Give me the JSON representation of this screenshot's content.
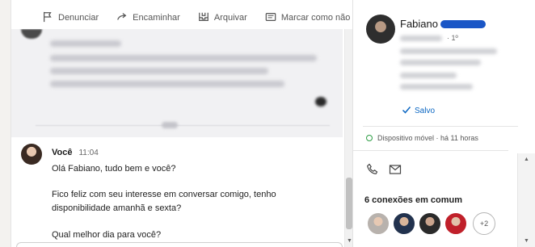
{
  "toolbar": {
    "report_label": "Denunciar",
    "forward_label": "Encaminhar",
    "archive_label": "Arquivar",
    "mark_unread_label": "Marcar como não lida"
  },
  "message": {
    "sender": "Você",
    "time": "11:04",
    "lines": [
      "Olá Fabiano, tudo bem e você?",
      "Fico feliz com seu interesse em conversar comigo, tenho",
      "disponibilidade amanhã e sexta?",
      "Qual melhor dia para você?"
    ]
  },
  "profile": {
    "name": "Fabiano",
    "degree": "· 1º",
    "saved_label": "Salvo",
    "status": "Dispositivo móvel · há 11 horas",
    "mutual_title": "6 conexões em comum",
    "mutual_more": "+2"
  },
  "icons": {
    "report": "flag-icon",
    "forward": "forward-arrow-icon",
    "archive": "archive-icon",
    "mark_unread": "envelope-icon",
    "phone": "phone-icon",
    "email": "mail-icon",
    "saved": "check-icon"
  },
  "colors": {
    "link_blue": "#0a66c2",
    "online_green": "#2e9e45",
    "redaction_blue": "#1a56c6"
  }
}
